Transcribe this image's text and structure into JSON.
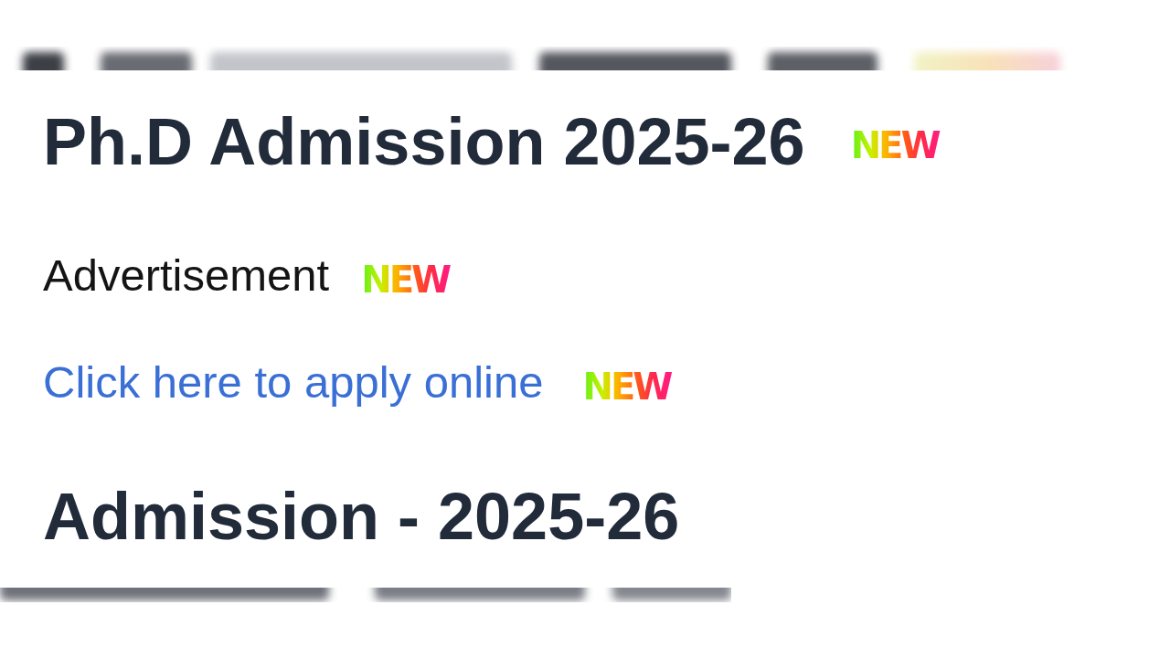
{
  "heading": {
    "text": "Ph.D Admission 2025-26",
    "badge": "NEW"
  },
  "notices": [
    {
      "kind": "plain",
      "text": "Advertisement",
      "badge": "NEW"
    },
    {
      "kind": "link",
      "text": "Click here to apply online",
      "badge": "NEW"
    }
  ],
  "section_heading": {
    "text": "Admission - 2025-26"
  }
}
